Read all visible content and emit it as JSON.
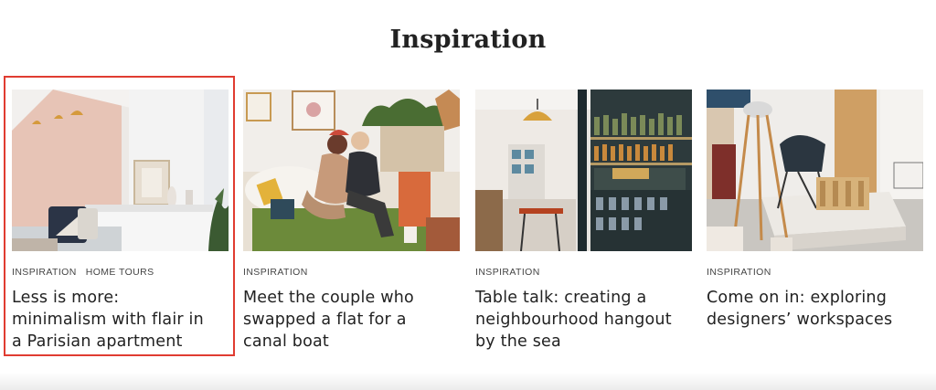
{
  "section": {
    "title": "Inspiration"
  },
  "cards": [
    {
      "tags": [
        "INSPIRATION",
        "HOME TOURS"
      ],
      "title_lines": [
        "Less is more:",
        "minimalism with flair in",
        "a Parisian apartment"
      ],
      "image": "minimal-living-room-photo"
    },
    {
      "tags": [
        "INSPIRATION"
      ],
      "title_lines": [
        "Meet the couple who",
        "swapped a flat for a",
        "canal boat"
      ],
      "image": "couple-on-sofa-photo"
    },
    {
      "tags": [
        "INSPIRATION"
      ],
      "title_lines": [
        "Table talk: creating a",
        "neighbourhood hangout",
        "by the sea"
      ],
      "image": "cafe-bar-interior-photo"
    },
    {
      "tags": [
        "INSPIRATION"
      ],
      "title_lines": [
        "Come on in: exploring",
        "designers’ workspaces"
      ],
      "image": "designer-studio-photo"
    }
  ],
  "colors": {
    "highlight": "#e03c31",
    "text": "#222222"
  }
}
